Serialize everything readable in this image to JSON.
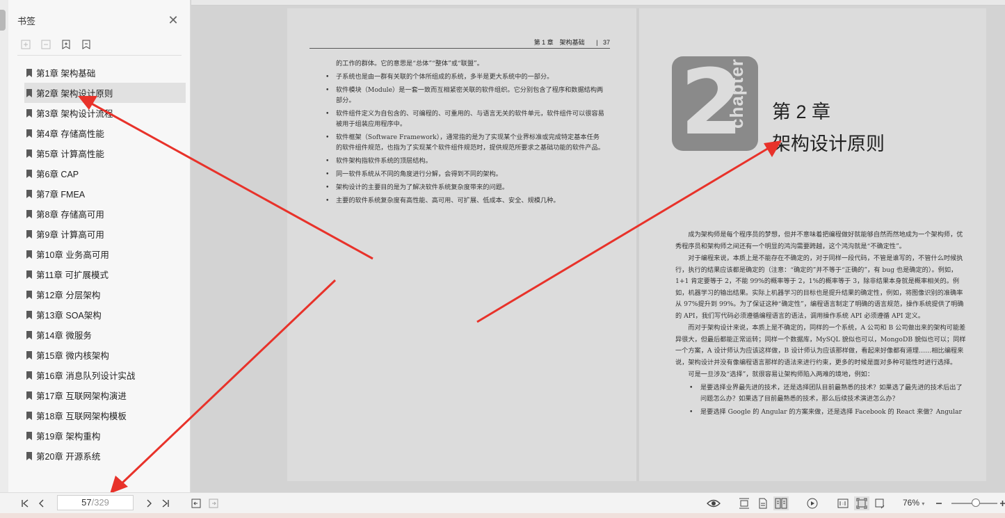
{
  "sidebar": {
    "title": "书签",
    "items": [
      {
        "label": "第1章 架构基础",
        "active": false
      },
      {
        "label": "第2章 架构设计原则",
        "active": true
      },
      {
        "label": "第3章 架构设计流程",
        "active": false
      },
      {
        "label": "第4章 存储高性能",
        "active": false
      },
      {
        "label": "第5章 计算高性能",
        "active": false
      },
      {
        "label": "第6章 CAP",
        "active": false
      },
      {
        "label": "第7章 FMEA",
        "active": false
      },
      {
        "label": "第8章 存储高可用",
        "active": false
      },
      {
        "label": "第9章 计算高可用",
        "active": false
      },
      {
        "label": "第10章 业务高可用",
        "active": false
      },
      {
        "label": "第11章 可扩展模式",
        "active": false
      },
      {
        "label": "第12章 分层架构",
        "active": false
      },
      {
        "label": "第13章 SOA架构",
        "active": false
      },
      {
        "label": "第14章 微服务",
        "active": false
      },
      {
        "label": "第15章 微内核架构",
        "active": false
      },
      {
        "label": "第16章 消息队列设计实战",
        "active": false
      },
      {
        "label": "第17章 互联网架构演进",
        "active": false
      },
      {
        "label": "第18章 互联网架构模板",
        "active": false
      },
      {
        "label": "第19章 架构重构",
        "active": false
      },
      {
        "label": "第20章 开源系统",
        "active": false
      }
    ]
  },
  "left_page": {
    "running_head": "第 1 章　架构基础",
    "page_number": "37",
    "intro": "的工作的群体。它的意思是“总体”“整体”或“联盟”。",
    "bullets": [
      "子系统也是由一群有关联的个体所组成的系统，多半是更大系统中的一部分。",
      "软件模块（Module）是一套一致而互相紧密关联的软件组织。它分别包含了程序和数据结构两部分。",
      "软件组件定义为自包含的、可编程的、可重用的、与语言无关的软件单元，软件组件可以很容易被用于组装应用程序中。",
      "软件框架（Software Framework），通常指的是为了实现某个业界标准或完成特定基本任务的软件组件规范，也指为了实现某个软件组件规范时，提供规范所要求之基础功能的软件产品。",
      "软件架构指软件系统的顶层结构。",
      "同一软件系统从不同的角度进行分解，会得到不同的架构。",
      "架构设计的主要目的是为了解决软件系统复杂度带来的问题。",
      "主要的软件系统复杂度有高性能、高可用、可扩展、低成本、安全、规模几种。"
    ]
  },
  "right_page": {
    "badge_number": "2",
    "badge_word": "chapter",
    "chapter_number": "第 2 章",
    "chapter_title": "架构设计原则",
    "paragraphs": [
      "成为架构师是每个程序员的梦想，但并不意味着把编程做好就能够自然而然地成为一个架构师，优秀程序员和架构师之间还有一个明显的鸿沟需要跨越，这个鸿沟就是“不确定性”。",
      "对于编程来说，本质上是不能存在不确定的，对于同样一段代码，不管是谁写的，不管什么时候执行，执行的结果应该都是确定的（注意：“确定的”并不等于“正确的”，有 bug 也是确定的）。例如，1+1 肯定要等于 2，不能 99%的概率等于 2，1%的概率等于 3，除非结果本身就是概率相关的。例如，机器学习的输出结果。实际上机器学习的目标也是提升结果的确定性，例如，将图像识别的准确率从 97%提升到 99%。为了保证这种“确定性”，编程语言制定了明确的语言规范，操作系统提供了明确的 API，我们写代码必须遵循编程语言的语法，调用操作系统 API 必须遵循 API 定义。",
      "而对于架构设计来说，本质上是不确定的，同样的一个系统，A 公司和 B 公司做出来的架构可能差异很大，但最后都能正常运转；同样一个数据库，MySQL 貌似也可以，MongoDB 貌似也可以；同样一个方案，A 设计师认为应该这样做，B 设计师认为应该那样做，看起来好像都有道理……相比编程来说，架构设计并没有像编程语言那样的语法来进行约束，更多的时候是面对多种可能性时进行选择。",
      "可是一旦涉及“选择”，就很容易让架构师陷入两难的境地，例如："
    ],
    "bullets": [
      "是要选择业界最先进的技术，还是选择团队目前最熟悉的技术？如果选了最先进的技术后出了问题怎么办？如果选了目前最熟悉的技术，那么后续技术演进怎么办？",
      "是要选择 Google 的 Angular 的方案来做，还是选择 Facebook 的 React 来做？Angular"
    ]
  },
  "toolbar": {
    "current_page": "57",
    "total_pages": "/329",
    "zoom": "76%",
    "zoom_level": 0.76
  },
  "colors": {
    "arrow": "#e8322a",
    "active_bookmark_bg": "#e1e1e1"
  }
}
